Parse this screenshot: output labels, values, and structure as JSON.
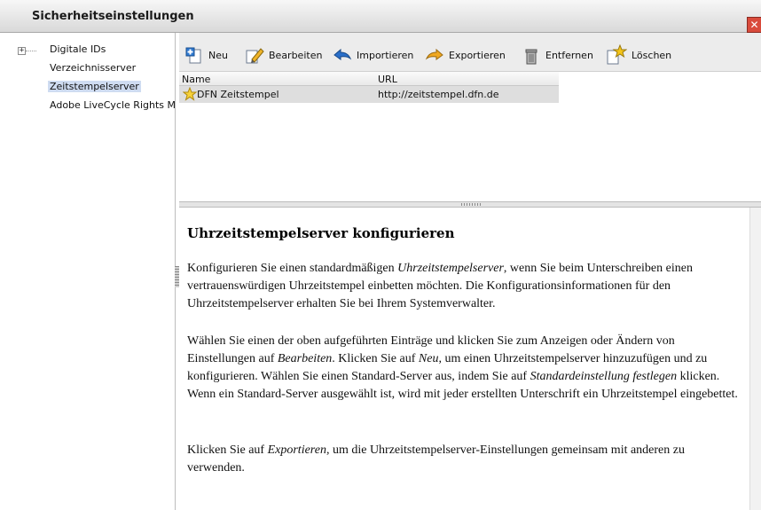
{
  "window": {
    "title": "Sicherheitseinstellungen",
    "close_glyph": "✕"
  },
  "tree": {
    "expander_glyph": "+",
    "items": [
      {
        "label": "Digitale IDs"
      },
      {
        "label": "Verzeichnisserver"
      },
      {
        "label": "Zeitstempelserver"
      },
      {
        "label": "Adobe LiveCycle Rights Ma"
      }
    ]
  },
  "toolbar": {
    "new_label": "Neu",
    "edit_label": "Bearbeiten",
    "import_label": "Importieren",
    "export_label": "Exportieren",
    "remove_label": "Entfernen",
    "delete_label": "Löschen"
  },
  "list": {
    "columns": [
      "Name",
      "URL"
    ],
    "rows": [
      {
        "name": "DFN Zeitstempel",
        "url": "http://zeitstempel.dfn.de"
      }
    ]
  },
  "help": {
    "title": "Uhrzeitstempelserver konfigurieren",
    "p1": {
      "a": "Konfigurieren Sie einen standardmäßigen ",
      "b": "Uhrzeitstempelserver",
      "c": ", wenn Sie beim Unterschreiben einen vertrauenswürdigen Uhrzeitstempel einbetten möchten. Die Konfigurationsinformationen für den Uhrzeitstempelserver erhalten Sie bei Ihrem Systemverwalter."
    },
    "p2": {
      "a": "Wählen Sie einen der oben aufgeführten Einträge und klicken Sie zum Anzeigen oder Ändern von Einstellungen auf ",
      "b": "Bearbeiten",
      "c": ". Klicken Sie auf ",
      "d": "Neu",
      "e": ", um einen Uhrzeitstempelserver hinzuzufügen und zu konfigurieren. Wählen Sie einen Standard-Server aus, indem Sie auf ",
      "f": "Standardeinstellung festlegen",
      "g": " klicken. Wenn ein Standard-Server ausgewählt ist, wird mit jeder erstellten Unterschrift ein Uhrzeitstempel eingebettet."
    },
    "p3": {
      "a": "Klicken Sie auf ",
      "b": "Exportieren",
      "c": ", um die Uhrzeitstempelserver-Einstellungen gemeinsam mit anderen zu verwenden."
    }
  },
  "colors": {
    "selection": "#cfdcf1",
    "row_selected": "#dedede",
    "close_button": "#d94b3c"
  }
}
